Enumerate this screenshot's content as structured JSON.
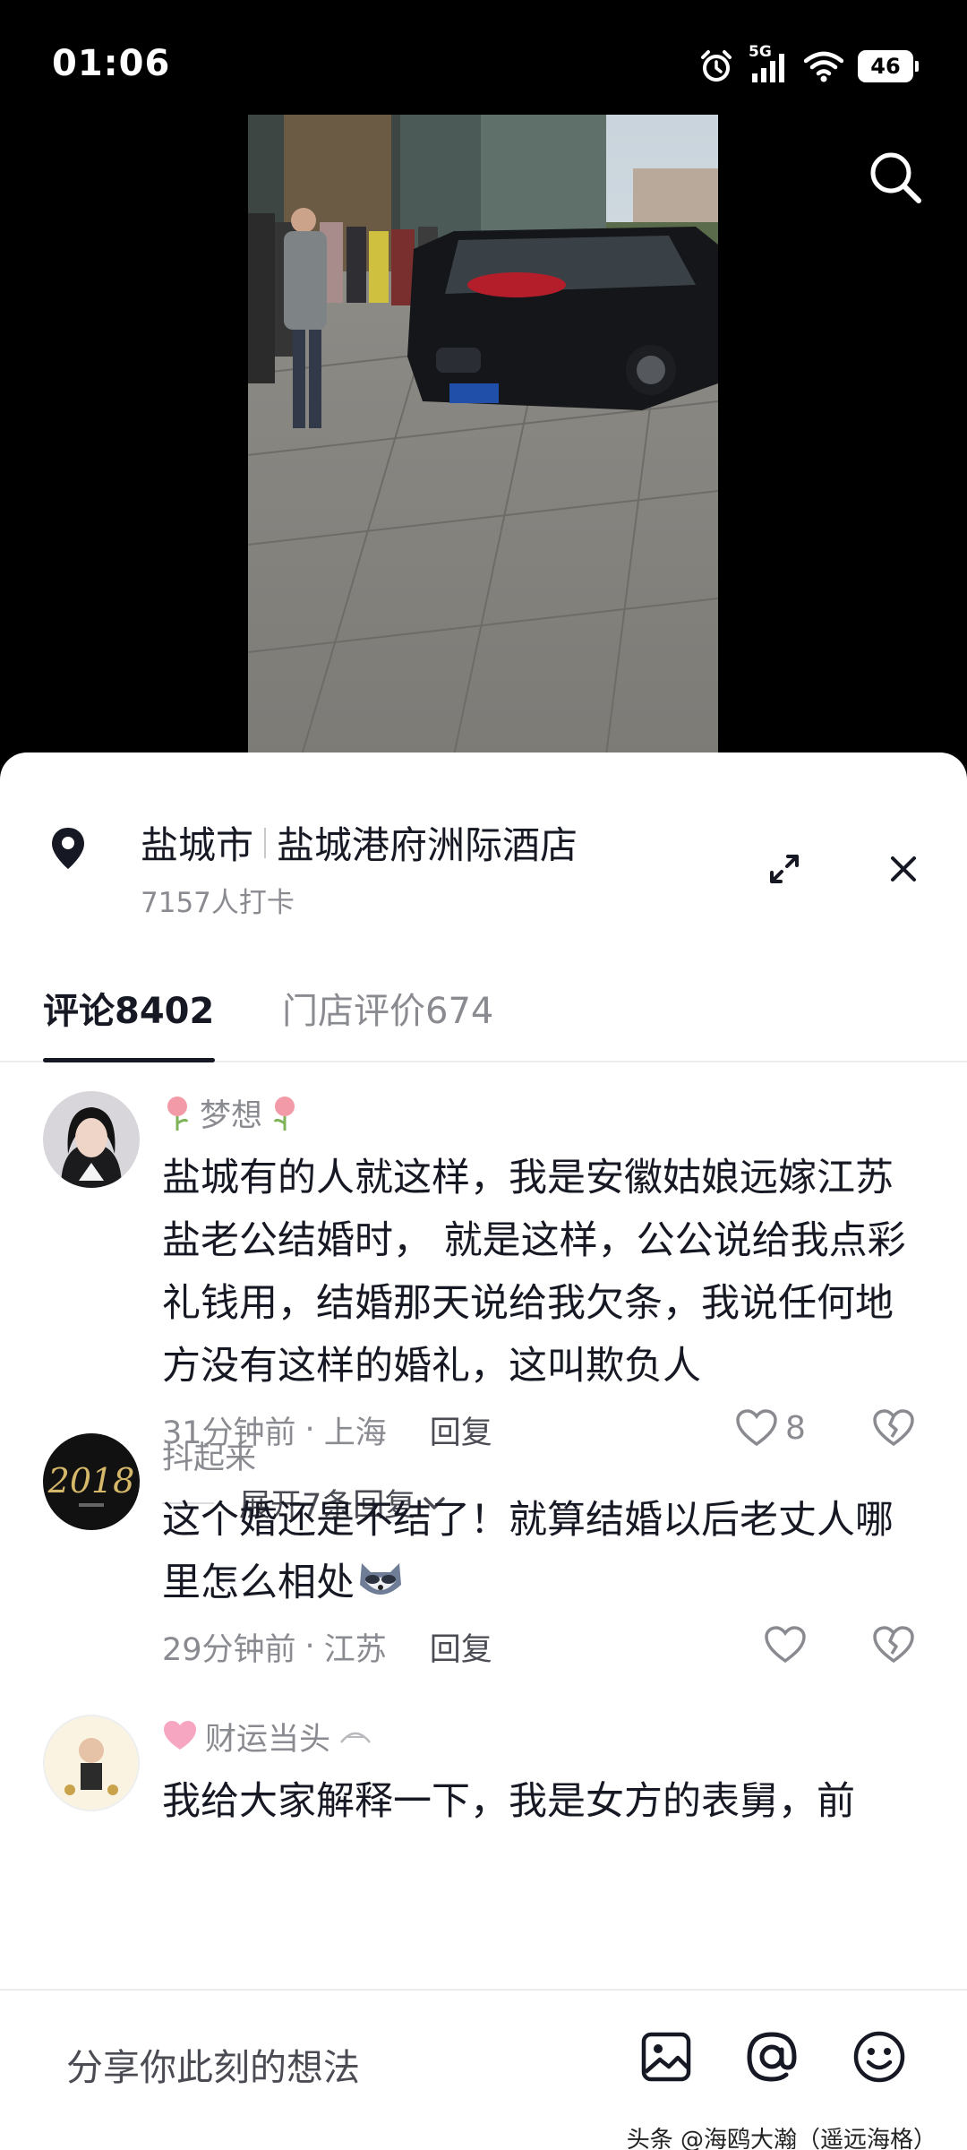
{
  "status_bar": {
    "time": "01:06",
    "network": "5G",
    "battery": "46"
  },
  "location": {
    "city": "盐城市",
    "venue": "盐城港府洲际酒店",
    "checkins": "7157人打卡"
  },
  "tabs": [
    {
      "label": "评论8402",
      "active": true
    },
    {
      "label": "门店评价674",
      "active": false
    }
  ],
  "comments": [
    {
      "name": "梦想",
      "text": "盐城有的人就这样，我是安徽姑娘远嫁江苏盐老公结婚时， 就是这样，公公说给我点彩礼钱用，结婚那天说给我欠条，我说任何地方没有这样的婚礼，这叫欺负人",
      "time": "31分钟前",
      "place": "上海",
      "reply": "回复",
      "likes": "8",
      "expand": "展开7条回复"
    },
    {
      "name": "抖起来",
      "text": "这个婚还是不结了！就算结婚以后老丈人哪里怎么相处",
      "time": "29分钟前",
      "place": "江苏",
      "reply": "回复",
      "likes": ""
    },
    {
      "name": "财运当头",
      "text": "我给大家解释一下，我是女方的表舅，前"
    }
  ],
  "separator": "·",
  "input": {
    "placeholder": "分享你此刻的想法"
  },
  "watermark": "头条 @海鸥大瀚（遥远海格）",
  "colors": {
    "text_primary": "#161823",
    "text_secondary": "#8a8b91",
    "background": "#ffffff"
  }
}
